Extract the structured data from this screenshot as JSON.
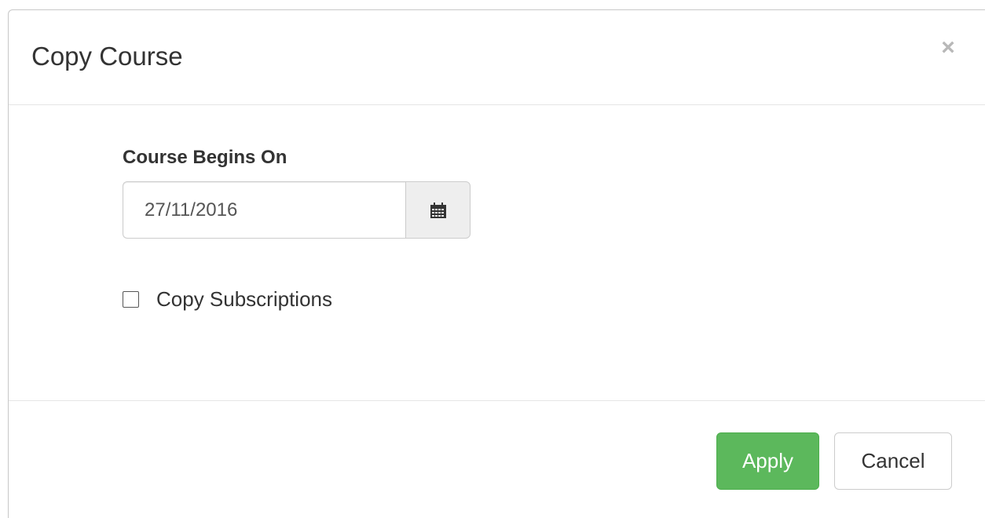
{
  "modal": {
    "title": "Copy Course",
    "close_label": "×"
  },
  "form": {
    "begins_label": "Course Begins On",
    "date_value": "27/11/2016",
    "calendar_icon": "calendar-icon",
    "copy_subscriptions_label": "Copy Subscriptions",
    "copy_subscriptions_checked": false
  },
  "footer": {
    "apply_label": "Apply",
    "cancel_label": "Cancel"
  },
  "colors": {
    "apply_bg": "#5cb85c",
    "addon_bg": "#eeeeee",
    "close_color": "#b8b8b8"
  }
}
